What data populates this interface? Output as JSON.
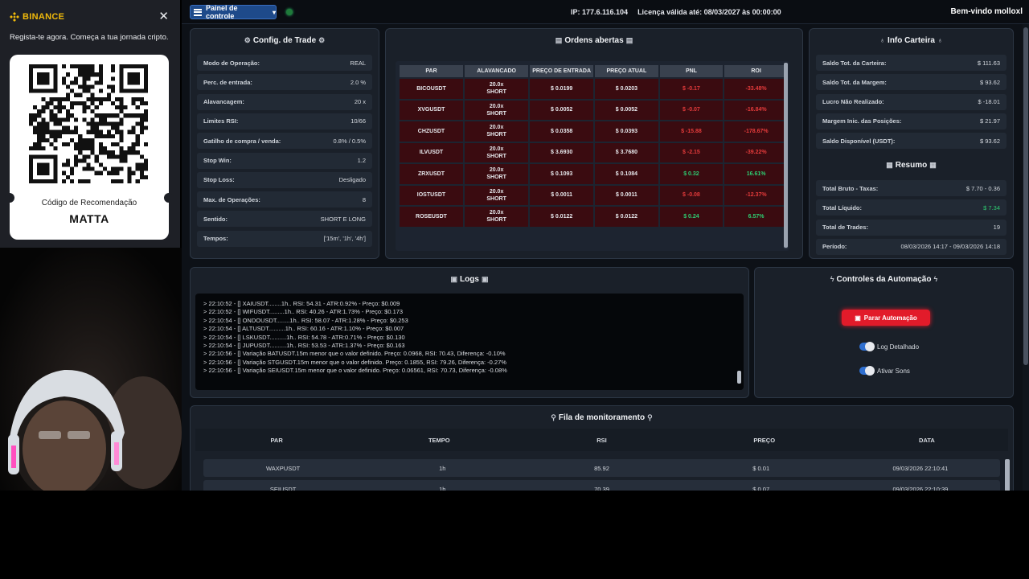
{
  "topbar": {
    "panel_label": "Painel de controle",
    "ip": "IP: 177.6.116.104",
    "license": "Licença válida até: 08/03/2027 às 00:00:00",
    "welcome": "Bem-vindo molloxl"
  },
  "config": {
    "title": "Config. de Trade",
    "rows": [
      {
        "k": "Modo de Operação:",
        "v": "REAL"
      },
      {
        "k": "Perc. de entrada:",
        "v": "2.0 %"
      },
      {
        "k": "Alavancagem:",
        "v": "20 x"
      },
      {
        "k": "Limites RSI:",
        "v": "10/66"
      },
      {
        "k": "Gatilho de compra / venda:",
        "v": "0.8% / 0.5%"
      },
      {
        "k": "Stop Win:",
        "v": "1.2"
      },
      {
        "k": "Stop Loss:",
        "v": "Desligado"
      },
      {
        "k": "Max. de Operações:",
        "v": "8"
      },
      {
        "k": "Sentido:",
        "v": "SHORT E LONG"
      },
      {
        "k": "Tempos:",
        "v": "['15m', '1h', '4h']"
      }
    ]
  },
  "orders": {
    "title": "Ordens abertas",
    "headers": [
      "PAR",
      "ALAVANCADO",
      "PREÇO DE ENTRADA",
      "PREÇO ATUAL",
      "PNL",
      "ROI"
    ],
    "rows": [
      {
        "par": "BICOUSDT",
        "lev": "20.0x",
        "side": "SHORT",
        "entry": "$ 0.0199",
        "current": "$ 0.0203",
        "pnl": "$ -0.17",
        "roi": "-33.48%",
        "pnl_sign": "neg"
      },
      {
        "par": "XVGUSDT",
        "lev": "20.0x",
        "side": "SHORT",
        "entry": "$ 0.0052",
        "current": "$ 0.0052",
        "pnl": "$ -0.07",
        "roi": "-16.84%",
        "pnl_sign": "neg"
      },
      {
        "par": "CHZUSDT",
        "lev": "20.0x",
        "side": "SHORT",
        "entry": "$ 0.0358",
        "current": "$ 0.0393",
        "pnl": "$ -15.88",
        "roi": "-178.67%",
        "pnl_sign": "neg"
      },
      {
        "par": "ILVUSDT",
        "lev": "20.0x",
        "side": "SHORT",
        "entry": "$ 3.6930",
        "current": "$ 3.7680",
        "pnl": "$ -2.15",
        "roi": "-39.22%",
        "pnl_sign": "neg"
      },
      {
        "par": "ZRXUSDT",
        "lev": "20.0x",
        "side": "SHORT",
        "entry": "$ 0.1093",
        "current": "$ 0.1084",
        "pnl": "$ 0.32",
        "roi": "16.61%",
        "pnl_sign": "pos"
      },
      {
        "par": "IOSTUSDT",
        "lev": "20.0x",
        "side": "SHORT",
        "entry": "$ 0.0011",
        "current": "$ 0.0011",
        "pnl": "$ -0.08",
        "roi": "-12.37%",
        "pnl_sign": "neg"
      },
      {
        "par": "ROSEUSDT",
        "lev": "20.0x",
        "side": "SHORT",
        "entry": "$ 0.0122",
        "current": "$ 0.0122",
        "pnl": "$ 0.24",
        "roi": "6.57%",
        "pnl_sign": "pos"
      }
    ]
  },
  "wallet": {
    "title": "Info Carteira",
    "rows": [
      {
        "k": "Saldo Tot. da Carteira:",
        "v": "$ 111.63"
      },
      {
        "k": "Saldo Tot. da Margem:",
        "v": "$ 93.62"
      },
      {
        "k": "Lucro Não Realizado:",
        "v": "$ -18.01"
      },
      {
        "k": "Margem Inic. das Posições:",
        "v": "$ 21.97"
      },
      {
        "k": "Saldo Disponível (USDT):",
        "v": "$ 93.62"
      }
    ]
  },
  "summary": {
    "title": "Resumo",
    "rows": [
      {
        "k": "Total Bruto - Taxas:",
        "v": "$ 7.70 - 0.36"
      },
      {
        "k": "Total Líquido:",
        "v": "$ 7.34"
      },
      {
        "k": "Total de Trades:",
        "v": "19"
      },
      {
        "k": "Período:",
        "v": "08/03/2026 14:17 - 09/03/2026 14:18"
      }
    ]
  },
  "logs": {
    "title": "Logs",
    "lines": [
      "> 22:10:52 - [] XAIUSDT........1h.. RSI: 54.31 - ATR:0.92% - Preço: $0.009",
      "> 22:10:52 - [] WIFUSDT.........1h.. RSI: 40.26 - ATR:1.73% - Preço: $0.173",
      "> 22:10:54 - [] ONDOUSDT........1h.. RSI: 58.07 - ATR:1.28% - Preço: $0.253",
      "> 22:10:54 - [] ALTUSDT..........1h.. RSI: 60.16 - ATR:1.10% - Preço: $0.007",
      "> 22:10:54 - [] LSKUSDT..........1h.. RSI: 54.78 - ATR:0.71% - Preço: $0.130",
      "> 22:10:54 - [] JUPUSDT..........1h.. RSI: 53.53 - ATR:1.37% - Preço: $0.163",
      "> 22:10:56 - [] Variação BATUSDT.15m menor que o valor definido. Preço: 0.0968, RSI: 70.43, Diferença: -0.10%",
      "> 22:10:56 - [] Variação STGUSDT.15m menor que o valor definido. Preço: 0.1855, RSI: 79.26, Diferença: -0.27%",
      "> 22:10:56 - [] Variação SEIUSDT.15m menor que o valor definido. Preço: 0.06561, RSI: 70.73, Diferença: -0.08%"
    ]
  },
  "automation": {
    "title": "Controles da Automação",
    "stop_label": "Parar Automação",
    "toggle_log": "Log Detalhado",
    "toggle_sound": "Ativar Sons"
  },
  "monitor": {
    "title": "Fila de monitoramento",
    "headers": [
      "PAR",
      "TEMPO",
      "RSI",
      "PREÇO",
      "DATA"
    ],
    "rows": [
      [
        "WAXPUSDT",
        "1h",
        "85.92",
        "$ 0.01",
        "09/03/2026 22:10:41"
      ],
      [
        "SEIUSDT",
        "1h",
        "70.39",
        "$ 0.07",
        "09/03/2026 22:10:39"
      ]
    ]
  },
  "binance": {
    "brand": "BINANCE",
    "subtitle": "Regista-te agora. Começa a tua jornada cripto.",
    "code_label": "Código de Recomendação",
    "code": "MATTA"
  },
  "colors": {
    "positive": "#2ecc71",
    "negative": "#e43b3b",
    "stop_button": "#e21b2a",
    "brand": "#f0b90b"
  }
}
